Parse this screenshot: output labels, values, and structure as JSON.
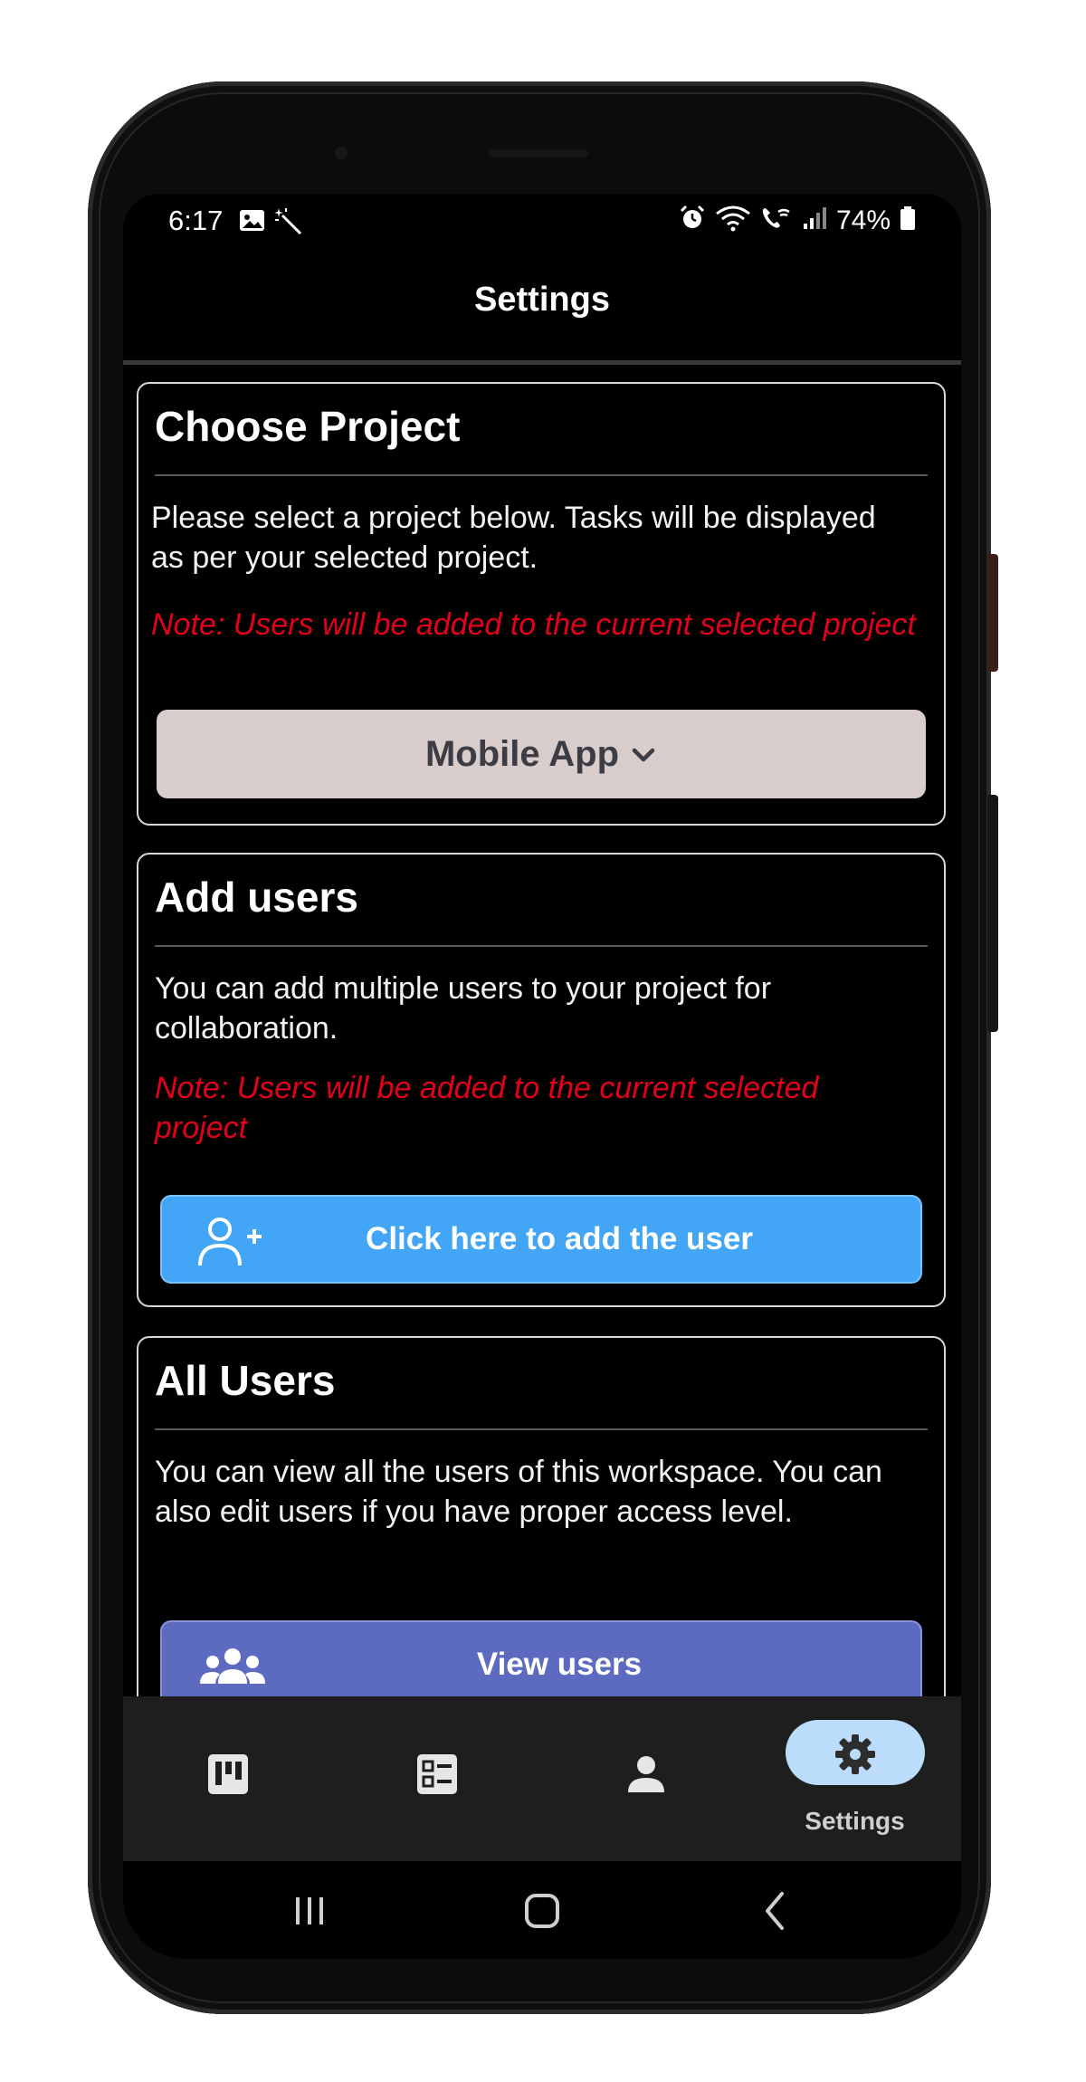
{
  "status_bar": {
    "time": "6:17",
    "battery": "74%",
    "icons": [
      "image-icon",
      "magic-wand-icon",
      "alarm-icon",
      "wifi-icon",
      "wifi-calling-icon",
      "signal-icon",
      "battery-icon"
    ]
  },
  "app_bar": {
    "title": "Settings"
  },
  "choose_project": {
    "title": "Choose Project",
    "description": "Please select a project below. Tasks will be displayed as per your selected project.",
    "note": "Note: Users will be added to the current selected project",
    "selected_project": "Mobile App"
  },
  "add_users": {
    "title": "Add users",
    "description": "You can add multiple users to your project for collaboration.",
    "note": "Note: Users will be added to the current selected project",
    "button_label": "Click here to add the user"
  },
  "all_users": {
    "title": "All Users",
    "description": "You can view all the users of this workspace. You can also edit users if you have proper access level.",
    "button_label": "View users"
  },
  "bottom_nav": {
    "items": [
      {
        "icon": "board-icon",
        "label": ""
      },
      {
        "icon": "task-list-icon",
        "label": ""
      },
      {
        "icon": "profile-icon",
        "label": ""
      },
      {
        "icon": "gear-icon",
        "label": "Settings",
        "active": true
      }
    ]
  },
  "colors": {
    "note_red": "#e4001b",
    "add_button_blue": "#42a5f5",
    "view_button_indigo": "#5c6bc0",
    "dropdown_bg": "#d8cdca",
    "active_pill": "#bcdcfb"
  }
}
